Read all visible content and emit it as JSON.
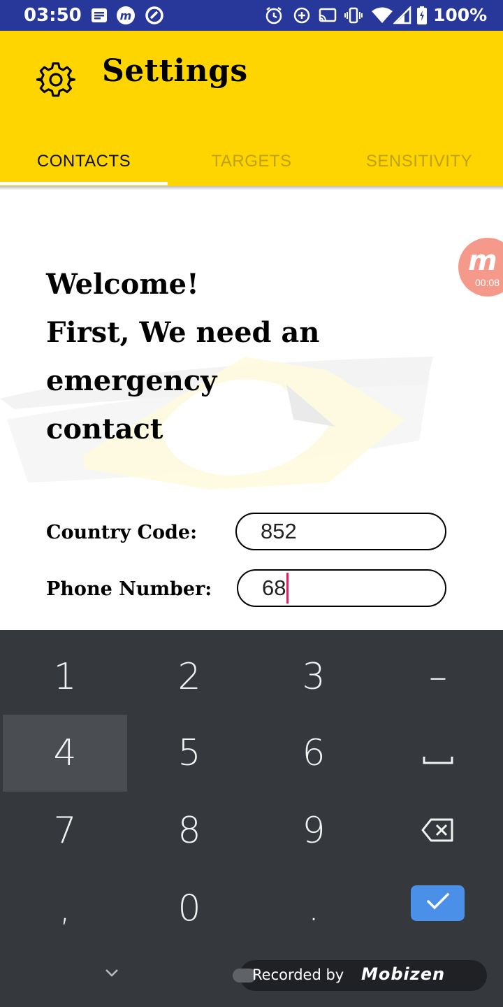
{
  "status_bar": {
    "time": "03:50",
    "battery": "100%",
    "left_icons": [
      "message-icon",
      "mobizen-icon",
      "vpn-icon"
    ],
    "right_icons": [
      "alarm-icon",
      "data-saver-icon",
      "cast-icon",
      "vibrate-icon",
      "wifi-icon",
      "signal-icon",
      "battery-icon"
    ]
  },
  "app_bar": {
    "title": "Settings",
    "icon": "gear-icon",
    "color": "#ffd500"
  },
  "tabs": [
    {
      "label": "CONTACTS",
      "active": true
    },
    {
      "label": "TARGETS",
      "active": false
    },
    {
      "label": "SENSITIVITY",
      "active": false
    }
  ],
  "recorder": {
    "timer": "00:08",
    "footer_label": "Recorded by",
    "brand": "Mobizen"
  },
  "content": {
    "welcome_lines": [
      "Welcome!",
      "First, We need an",
      "emergency",
      "contact"
    ],
    "country_code_label": "Country Code:",
    "country_code_value": "852",
    "phone_label": "Phone Number:",
    "phone_value": "68"
  },
  "keyboard": {
    "rows": [
      [
        "1",
        "2",
        "3",
        "–"
      ],
      [
        "4",
        "5",
        "6",
        "space-icon"
      ],
      [
        "7",
        "8",
        "9",
        "backspace-icon"
      ],
      [
        ",",
        "0",
        ".",
        "check-icon"
      ]
    ],
    "pressed_key": "4",
    "enter_color": "#4a8fe8"
  }
}
